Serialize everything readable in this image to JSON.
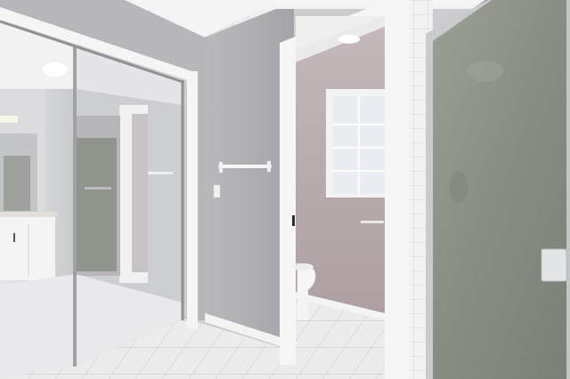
{
  "scene": {
    "kind": "photo",
    "subject": "bathroom"
  },
  "colors": {
    "wall_gray": "#a9a9ad",
    "wall_light": "#c7c6ca",
    "ceiling": "#f1f1f2",
    "door_trim": "#f4f4f4",
    "tile_floor": "#e9e9ea",
    "tile_grout": "#cfcfd2",
    "mirror_tint": "#d3d4d6",
    "shower_glass": "#8d9389",
    "toilet_room_wall": "#b8a9ab",
    "window_glass": "#e8ecf0",
    "chrome": "#d9dadc"
  }
}
